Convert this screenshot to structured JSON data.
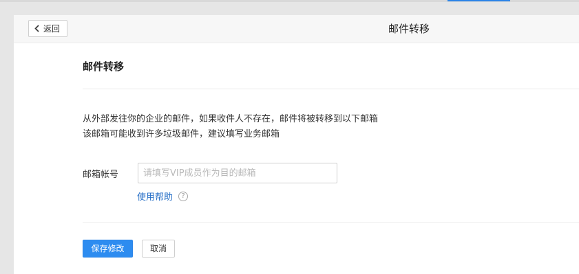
{
  "header": {
    "back_label": "返回",
    "title": "邮件转移"
  },
  "section": {
    "title": "邮件转移"
  },
  "description": {
    "line1": "从外部发往你的企业的邮件，如果收件人不存在，邮件将被转移到以下邮箱",
    "line2": "该邮箱可能收到许多垃圾邮件，建议填写业务邮箱"
  },
  "form": {
    "label": "邮箱帐号",
    "placeholder": "请填写VIP成员作为目的邮箱",
    "value": "",
    "help_link": "使用帮助",
    "help_icon": "question-circle-icon"
  },
  "actions": {
    "save_label": "保存修改",
    "cancel_label": "取消"
  },
  "colors": {
    "accent": "#2d8cf0",
    "link": "#2b72c8"
  }
}
